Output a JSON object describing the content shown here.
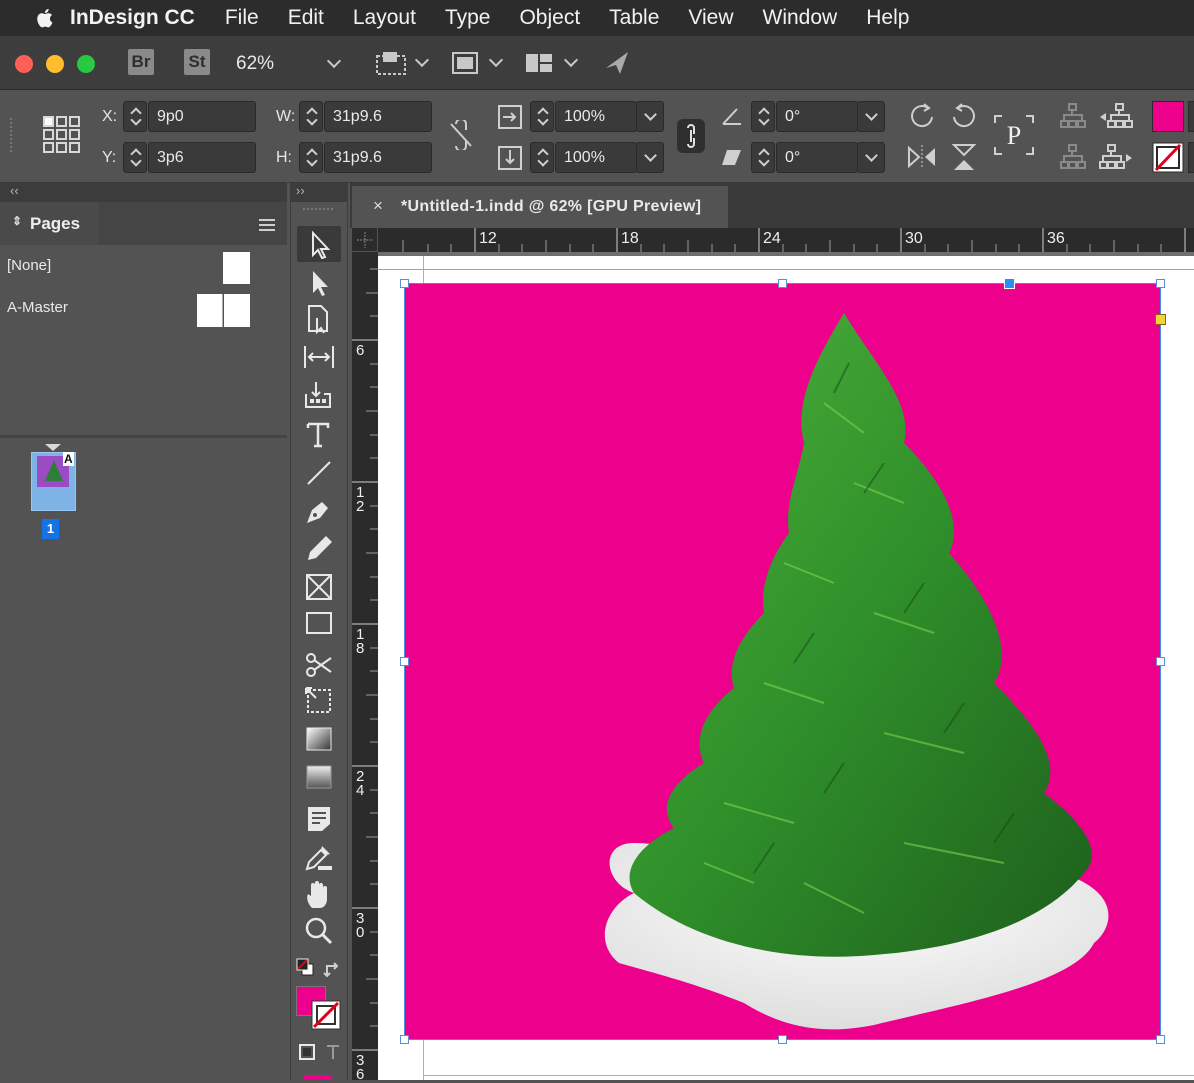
{
  "menubar": {
    "app_name": "InDesign CC",
    "items": [
      "File",
      "Edit",
      "Layout",
      "Type",
      "Object",
      "Table",
      "View",
      "Window",
      "Help"
    ]
  },
  "appbar": {
    "bridge_label": "Br",
    "stock_label": "St",
    "zoom": "62%"
  },
  "control": {
    "x_label": "X:",
    "x_value": "9p0",
    "y_label": "Y:",
    "y_value": "3p6",
    "w_label": "W:",
    "w_value": "31p9.6",
    "h_label": "H:",
    "h_value": "31p9.6",
    "scale_x": "100%",
    "scale_y": "100%",
    "rotate": "0°",
    "shear": "0°",
    "fill_color": "#ec008c"
  },
  "pages_panel": {
    "title": "Pages",
    "masters": [
      {
        "label": "[None]"
      },
      {
        "label": "A-Master"
      }
    ],
    "page_prefix": "A",
    "page_number": "1"
  },
  "document": {
    "tab_title": "*Untitled-1.indd @ 62% [GPU Preview]",
    "ruler_h": [
      "12",
      "18",
      "24",
      "30",
      "36"
    ],
    "ruler_v": [
      "6",
      "1 2",
      "1 8",
      "2 4",
      "3 0",
      "3 6"
    ],
    "frame_color": "#ec008c"
  }
}
